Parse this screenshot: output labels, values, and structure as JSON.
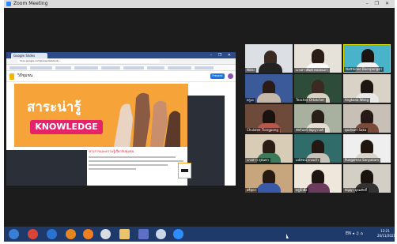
{
  "window": {
    "title": "Zoom Meeting",
    "controls": "– ❐ ✕",
    "frame_color": "#1c1c1c"
  },
  "share": {
    "browser_tab": "Google Slides",
    "url": "docs.google.com/presentation/d/...",
    "doc_name": "วิถีชุมชน",
    "present_label": "Present",
    "slide_title": "สาระน่ารู้",
    "slide_pill": "KNOWLEDGE",
    "slide_heading": "ข่าวสารและความรู้เกี่ยวกับชุมชน",
    "slide_colors": {
      "background": "#f6a43a",
      "pill": "#e6226a"
    }
  },
  "participants": [
    {
      "name": "Nikki"
    },
    {
      "name": "นางสาวพิมพ์ พลอยนภา"
    },
    {
      "name": "Natthinee Boonpengsri",
      "active": true
    },
    {
      "name": "ครูเอ"
    },
    {
      "name": "Teacher Ortatcher"
    },
    {
      "name": "Angkana Wong"
    },
    {
      "name": "Chulalee Tlongpong"
    },
    {
      "name": "พัชรินทร์ ปัญญาวงศ์"
    },
    {
      "name": "คุณจันทร์ Saka"
    },
    {
      "name": "นางสาว สุนันทา"
    },
    {
      "name": "มณีรัตน์ ดวงแก้ว"
    },
    {
      "name": "Pungamas Sanyakam"
    },
    {
      "name": "ศรีสุดา"
    },
    {
      "name": "ครูน้ำผึ้ง"
    },
    {
      "name": "กัญญา อุดมศักดิ์"
    }
  ],
  "taskbar": {
    "apps": [
      "start-button",
      "chrome",
      "ie",
      "media-player",
      "firefox",
      "paint",
      "file-explorer",
      "app-viewer",
      "clock-app",
      "zoom"
    ],
    "clock_time": "13:21",
    "clock_date": "20/11/2021",
    "tray": "EN ◂ ♫ ⌂"
  }
}
